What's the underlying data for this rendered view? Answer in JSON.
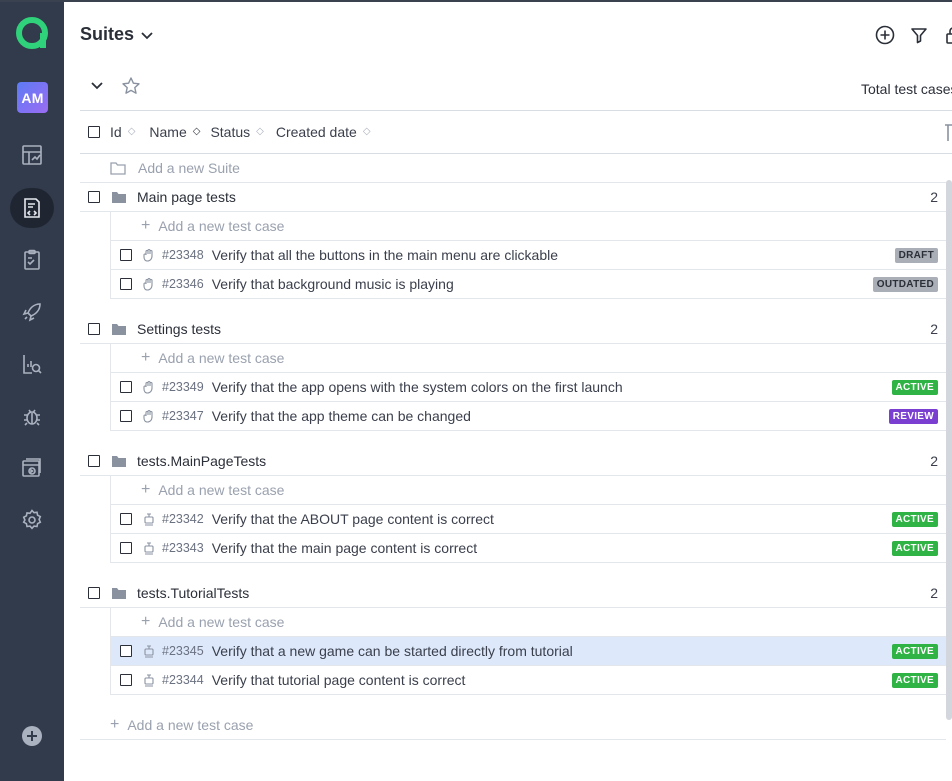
{
  "sidebar": {
    "avatar_initials": "AM",
    "items": [
      {
        "icon": "dashboard-icon"
      },
      {
        "icon": "test-cases-icon",
        "active": true
      },
      {
        "icon": "test-plans-icon"
      },
      {
        "icon": "launches-icon"
      },
      {
        "icon": "analytics-icon"
      },
      {
        "icon": "defects-icon"
      },
      {
        "icon": "runs-icon"
      },
      {
        "icon": "settings-icon"
      }
    ],
    "add_icon": "plus-circle-icon"
  },
  "header": {
    "title": "Suites",
    "icons": [
      "add-circle-icon",
      "filter-icon",
      "lock-icon"
    ],
    "total_label": "Total test cases"
  },
  "table": {
    "columns": [
      "Id",
      "Name",
      "Status",
      "Created date"
    ],
    "add_suite_label": "Add a new Suite"
  },
  "suites": [
    {
      "name": "Main page tests",
      "count": "2",
      "add_case_label": "Add a new test case",
      "cases": [
        {
          "id": "#23348",
          "title": "Verify that all the buttons in the main menu are clickable",
          "status": "DRAFT",
          "type": "manual"
        },
        {
          "id": "#23346",
          "title": "Verify that background music is playing",
          "status": "OUTDATED",
          "type": "manual"
        }
      ]
    },
    {
      "name": "Settings tests",
      "count": "2",
      "add_case_label": "Add a new test case",
      "cases": [
        {
          "id": "#23349",
          "title": "Verify that the app opens with the system colors on the first launch",
          "status": "ACTIVE",
          "type": "manual"
        },
        {
          "id": "#23347",
          "title": "Verify that the app theme can be changed",
          "status": "REVIEW",
          "type": "manual"
        }
      ]
    },
    {
      "name": "tests.MainPageTests",
      "count": "2",
      "add_case_label": "Add a new test case",
      "cases": [
        {
          "id": "#23342",
          "title": "Verify that the ABOUT page content is correct",
          "status": "ACTIVE",
          "type": "automated"
        },
        {
          "id": "#23343",
          "title": "Verify that the main page content is correct",
          "status": "ACTIVE",
          "type": "automated"
        }
      ]
    },
    {
      "name": "tests.TutorialTests",
      "count": "2",
      "add_case_label": "Add a new test case",
      "cases": [
        {
          "id": "#23345",
          "title": "Verify that a new game can be started directly from tutorial",
          "status": "ACTIVE",
          "type": "automated",
          "selected": true
        },
        {
          "id": "#23344",
          "title": "Verify that tutorial page content is correct",
          "status": "ACTIVE",
          "type": "automated"
        }
      ]
    }
  ],
  "bottom_add_label": "Add a new test case",
  "colors": {
    "sidebar_bg": "#323b4b",
    "logo": "#2fd27a",
    "active": "#2fb344",
    "review": "#7a3fd1",
    "draft": "#a9aeb7",
    "selected_row": "#dde9fb"
  }
}
